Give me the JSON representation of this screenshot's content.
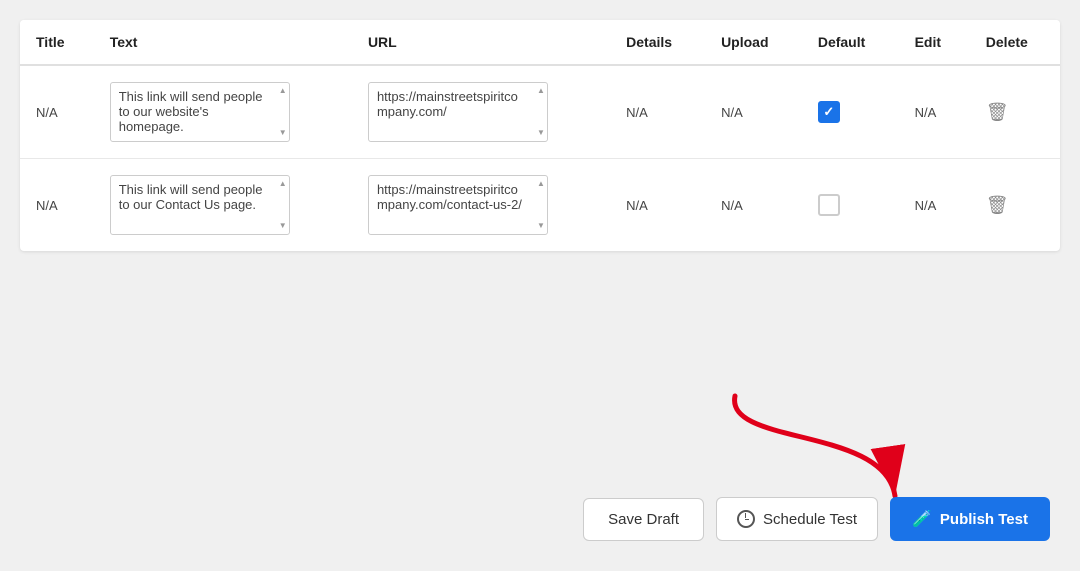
{
  "table": {
    "columns": [
      "Title",
      "Text",
      "URL",
      "Details",
      "Upload",
      "Default",
      "Edit",
      "Delete"
    ],
    "rows": [
      {
        "title": "N/A",
        "text": "This link will send people to our website's homepage.",
        "url": "https://mainstreetspiritcompany.com/",
        "details": "N/A",
        "upload": "N/A",
        "default_checked": true,
        "edit": "N/A"
      },
      {
        "title": "N/A",
        "text": "This link will send people to our Contact Us page.",
        "url": "https://mainstreetspiritcompany.com/contact-us-2/",
        "details": "N/A",
        "upload": "N/A",
        "default_checked": false,
        "edit": "N/A"
      }
    ]
  },
  "buttons": {
    "save_draft": "Save Draft",
    "schedule_test": "Schedule Test",
    "publish_test": "Publish Test"
  }
}
